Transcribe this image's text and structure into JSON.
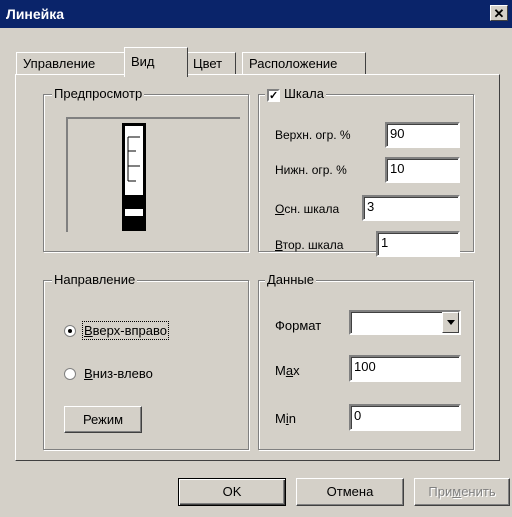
{
  "window": {
    "title": "Линейка",
    "close_glyph": "✕"
  },
  "tabs": [
    {
      "label": "Управление",
      "active": false
    },
    {
      "label": "Вид",
      "active": true
    },
    {
      "label": "Цвет",
      "active": false
    },
    {
      "label": "Расположение",
      "active": false
    }
  ],
  "preview": {
    "legend": "Предпросмотр",
    "upper_pct": 90,
    "lower_pct": 10,
    "main_ticks": 3,
    "minor_ticks": 1
  },
  "scale": {
    "legend": "Шкала",
    "checked": true,
    "upper_label": "Верхн. огр. %",
    "upper_value": "90",
    "lower_label": "Нижн. огр. %",
    "lower_value": "10",
    "main_label_first": "О",
    "main_label_rest": "сн. шкала",
    "main_value": "3",
    "minor_label_first": "В",
    "minor_label_rest": "тор. шкала",
    "minor_value": "1"
  },
  "direction": {
    "legend": "Направление",
    "option1_first": "В",
    "option1_rest": "верх-вправо",
    "option1_selected": true,
    "option2_first": "В",
    "option2_rest": "низ-влево",
    "option2_selected": false,
    "mode_button": "Режим"
  },
  "data": {
    "legend": "Данные",
    "format_label": "Формат",
    "format_value": "",
    "max_label_a": "М",
    "max_label_u": "a",
    "max_label_b": "x",
    "max_value": "100",
    "min_label_a": "M",
    "min_label_u": "i",
    "min_label_b": "n",
    "min_value": "0"
  },
  "buttons": {
    "ok": "OK",
    "cancel": "Отмена",
    "apply_a": "При",
    "apply_u": "м",
    "apply_b": "енить",
    "apply_disabled": true
  },
  "colors": {
    "titlebar": "#0a246a",
    "face": "#d4d0c8",
    "shadow": "#808080"
  },
  "icons": {
    "close": "close-icon",
    "check": "checkmark-icon",
    "dropdown": "chevron-down-icon",
    "radio": "radio-dot-icon"
  }
}
